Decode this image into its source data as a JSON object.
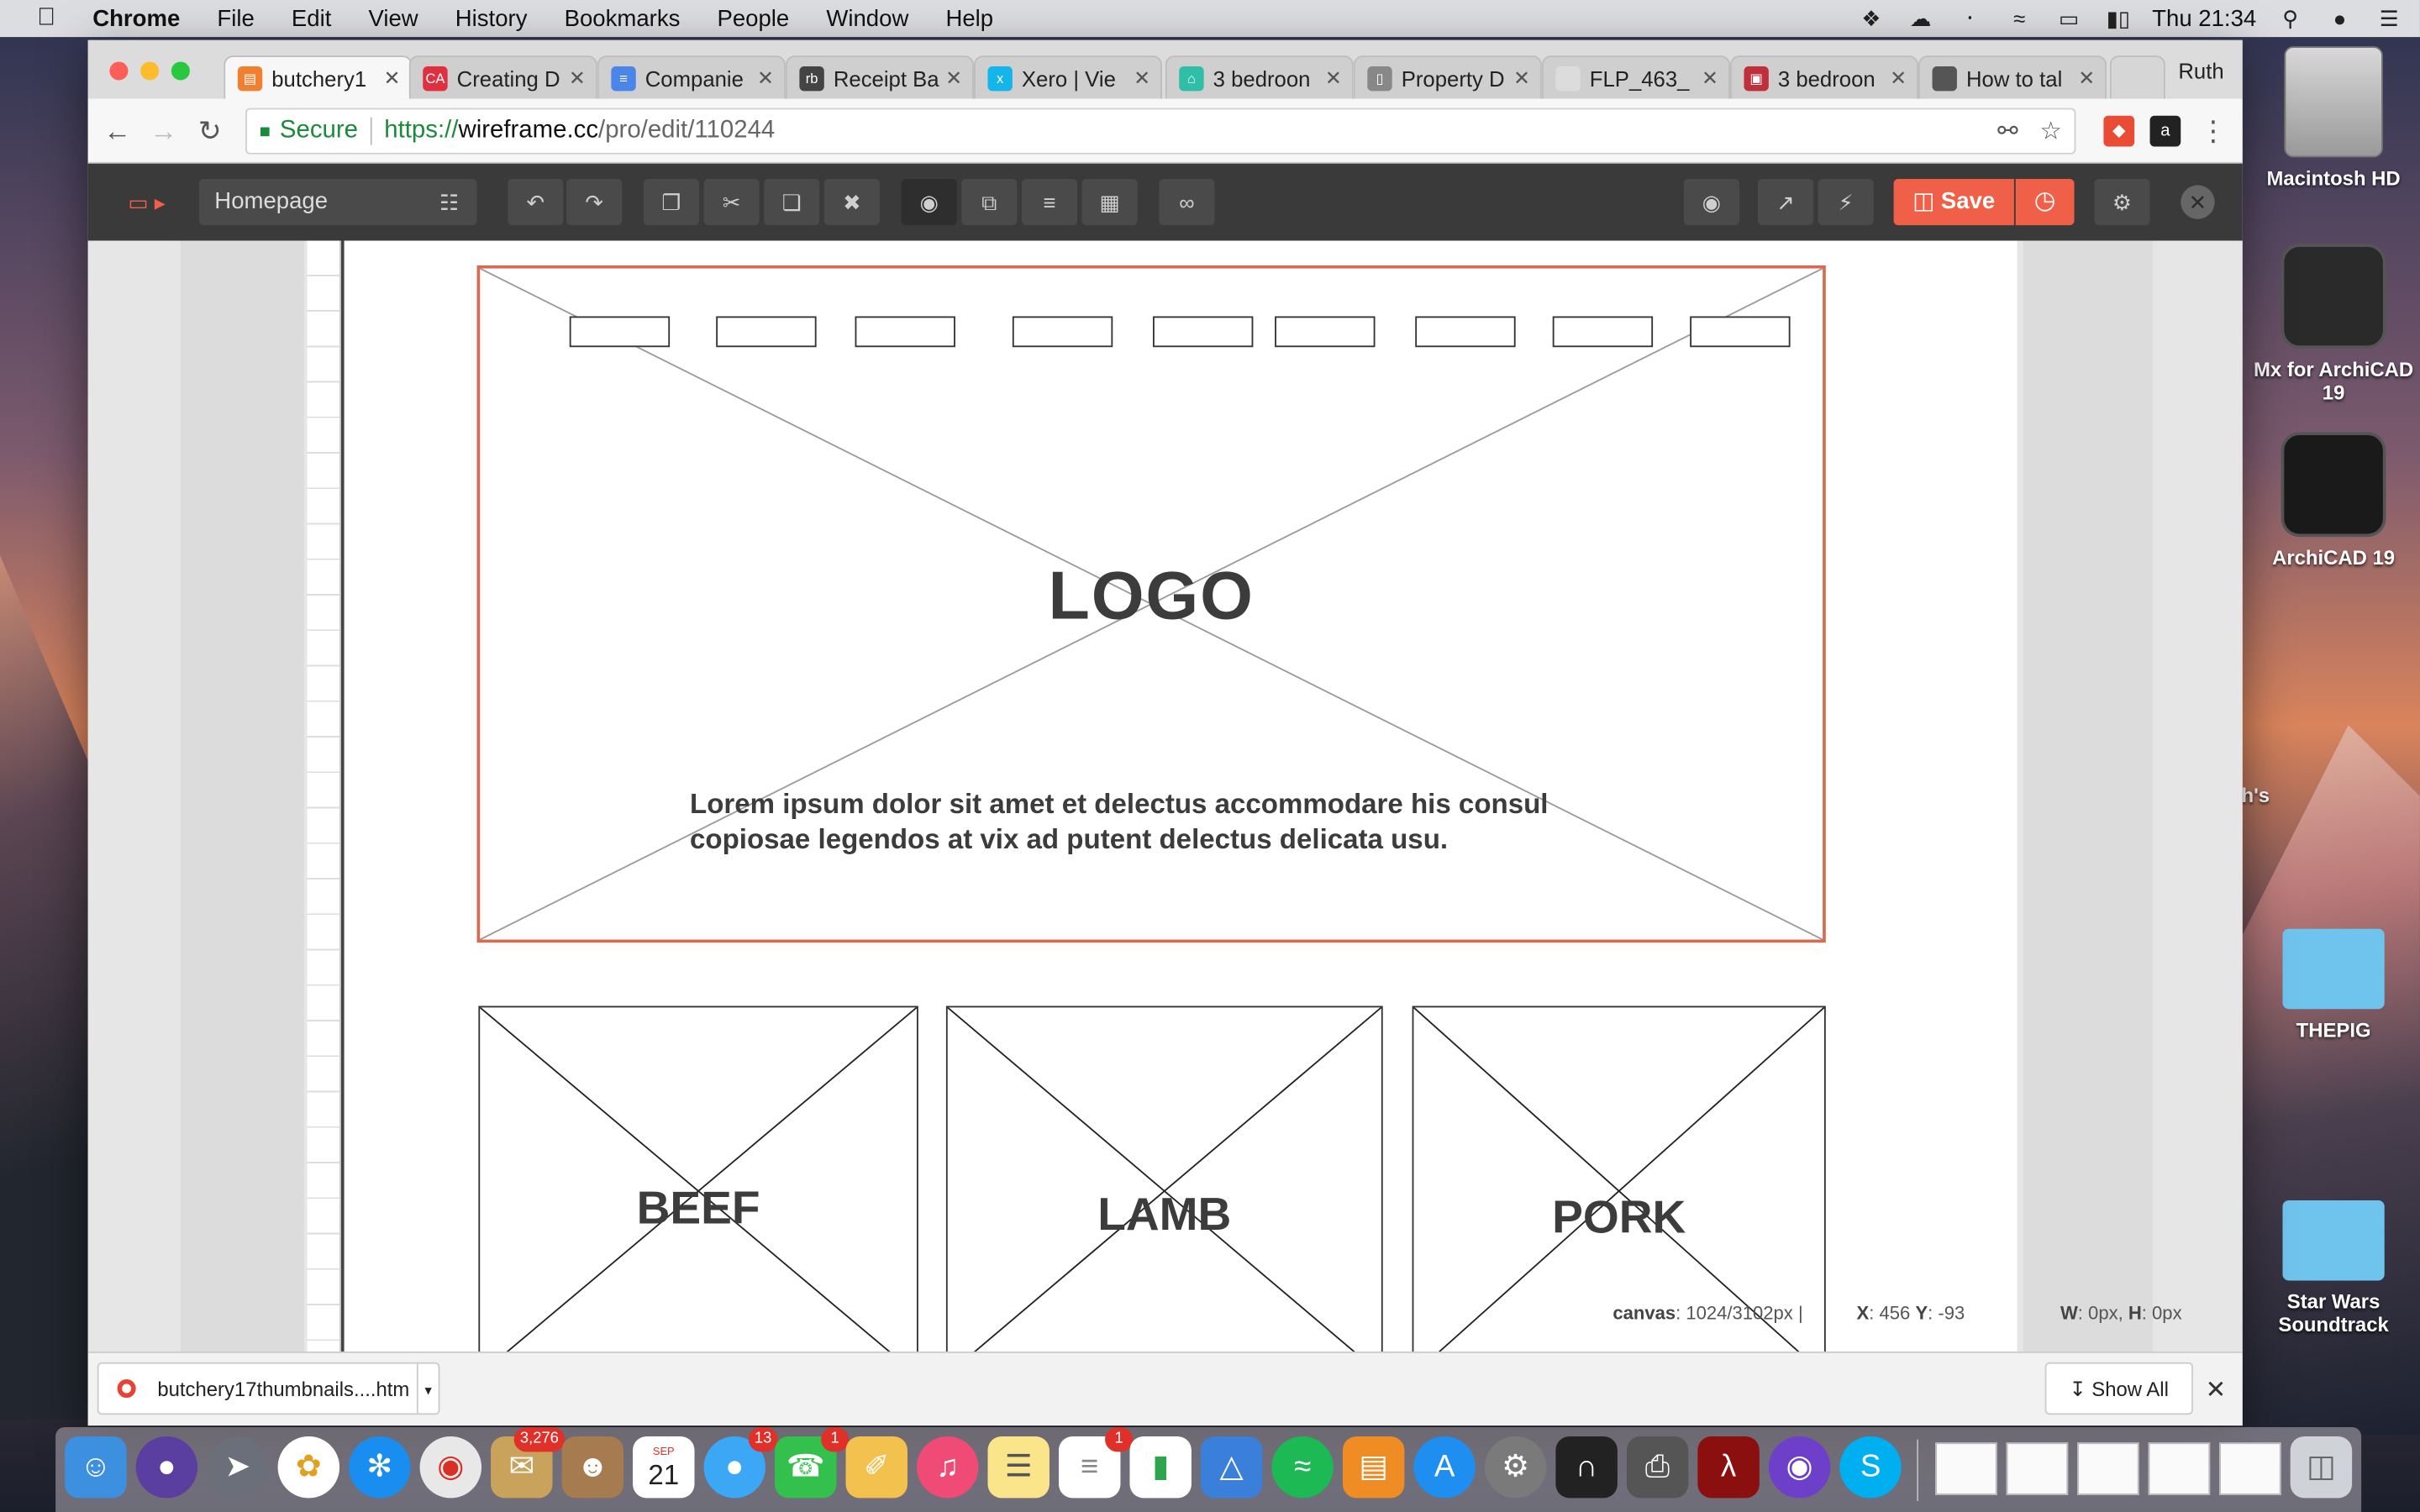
{
  "menubar": {
    "app": "Chrome",
    "items": [
      "File",
      "Edit",
      "View",
      "History",
      "Bookmarks",
      "People",
      "Window",
      "Help"
    ],
    "clock": "Thu 21:34"
  },
  "desktop": {
    "items": [
      {
        "label": "Macintosh HD",
        "icon": "hard-drive-icon"
      },
      {
        "label": "Mx for ArchiCAD 19",
        "icon": "app-icon"
      },
      {
        "label": "ArchiCAD 19",
        "icon": "archicad-icon"
      },
      {
        "label": "th's",
        "icon": "folder-icon"
      },
      {
        "label": "THEPIG",
        "icon": "folder-icon"
      },
      {
        "label": "Star Wars Soundtrack",
        "icon": "folder-icon"
      }
    ]
  },
  "tabs": [
    {
      "title": "butchery1",
      "color": "#f08030",
      "glyph": "▤"
    },
    {
      "title": "Creating D",
      "color": "#e03040",
      "glyph": "CA"
    },
    {
      "title": "Companie",
      "color": "#4a86e8",
      "glyph": "≡"
    },
    {
      "title": "Receipt Ba",
      "color": "#444444",
      "glyph": "rb"
    },
    {
      "title": "Xero | Vie",
      "color": "#13b5ea",
      "glyph": "x"
    },
    {
      "title": "3 bedroon",
      "color": "#2fbfa8",
      "glyph": "⌂"
    },
    {
      "title": "Property D",
      "color": "#888888",
      "glyph": "▯"
    },
    {
      "title": "FLP_463_",
      "color": "#dcdcdc",
      "glyph": ""
    },
    {
      "title": "3 bedroon",
      "color": "#c0303a",
      "glyph": "▣"
    },
    {
      "title": "How to tal",
      "color": "#555555",
      "glyph": ""
    }
  ],
  "profile": "Ruth",
  "omnibox": {
    "secure_label": "Secure",
    "scheme": "https://",
    "host": "wireframe.cc",
    "path": "/pro/edit/110244"
  },
  "app": {
    "page_name": "Homepage",
    "save_label": "Save"
  },
  "wireframe": {
    "nav_box_count": 9,
    "logo": "LOGO",
    "hero_text": "Lorem ipsum dolor sit amet et delectus accommodare his consul copiosae legendos at vix ad putent delectus delicata usu.",
    "tiles": [
      "BEEF",
      "LAMB",
      "PORK"
    ]
  },
  "status": {
    "canvas_label": "canvas",
    "canvas_value": "1024/3102px",
    "x_label": "X",
    "x_value": "456",
    "y_label": "Y",
    "y_value": "-93",
    "w_label": "W",
    "w_value": "0px",
    "h_label": "H",
    "h_value": "0px"
  },
  "downloads": {
    "file": "butchery17thumbnails....htm",
    "show_all": "Show All"
  },
  "dock": {
    "badges": {
      "mail": "3,276",
      "calendar_date": "21",
      "calendar_month": "SEP",
      "messages": "13",
      "facetime": "1",
      "reminders": "1"
    }
  }
}
